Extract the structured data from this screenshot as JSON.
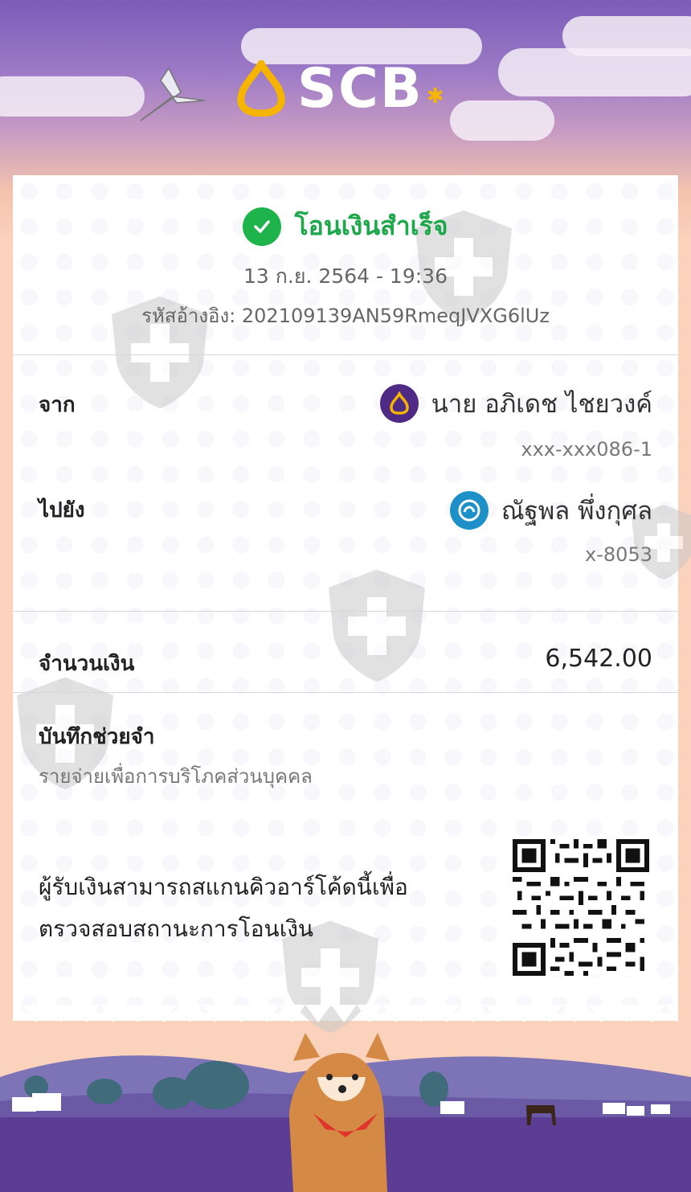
{
  "brand": {
    "name": "SCB"
  },
  "status": {
    "text": "โอนเงินสำเร็จ"
  },
  "transaction": {
    "datetime": "13 ก.ย. 2564 - 19:36",
    "reference": "รหัสอ้างอิง: 202109139AN59RmeqJVXG6lUz"
  },
  "from": {
    "label": "จาก",
    "name": "นาย อภิเดช ไชยวงค์",
    "account": "xxx-xxx086-1"
  },
  "to": {
    "label": "ไปยัง",
    "name": "ณัฐพล พึ่งกุศล",
    "account": "x-8053"
  },
  "amount": {
    "label": "จำนวนเงิน",
    "value": "6,542.00"
  },
  "memo": {
    "label": "บันทึกช่วยจำ",
    "text": "รายจ่ายเพื่อการบริโภคส่วนบุคคล"
  },
  "qr": {
    "line1": "ผู้รับเงินสามารถสแกนคิวอาร์โค้ดนี้เพื่อ",
    "line2": "ตรวจสอบสถานะการโอนเงิน"
  },
  "colors": {
    "success": "#1fb34c",
    "scb_purple": "#4e2a84",
    "kbank_blue": "#1e90c8",
    "scb_gold": "#f5b400"
  }
}
